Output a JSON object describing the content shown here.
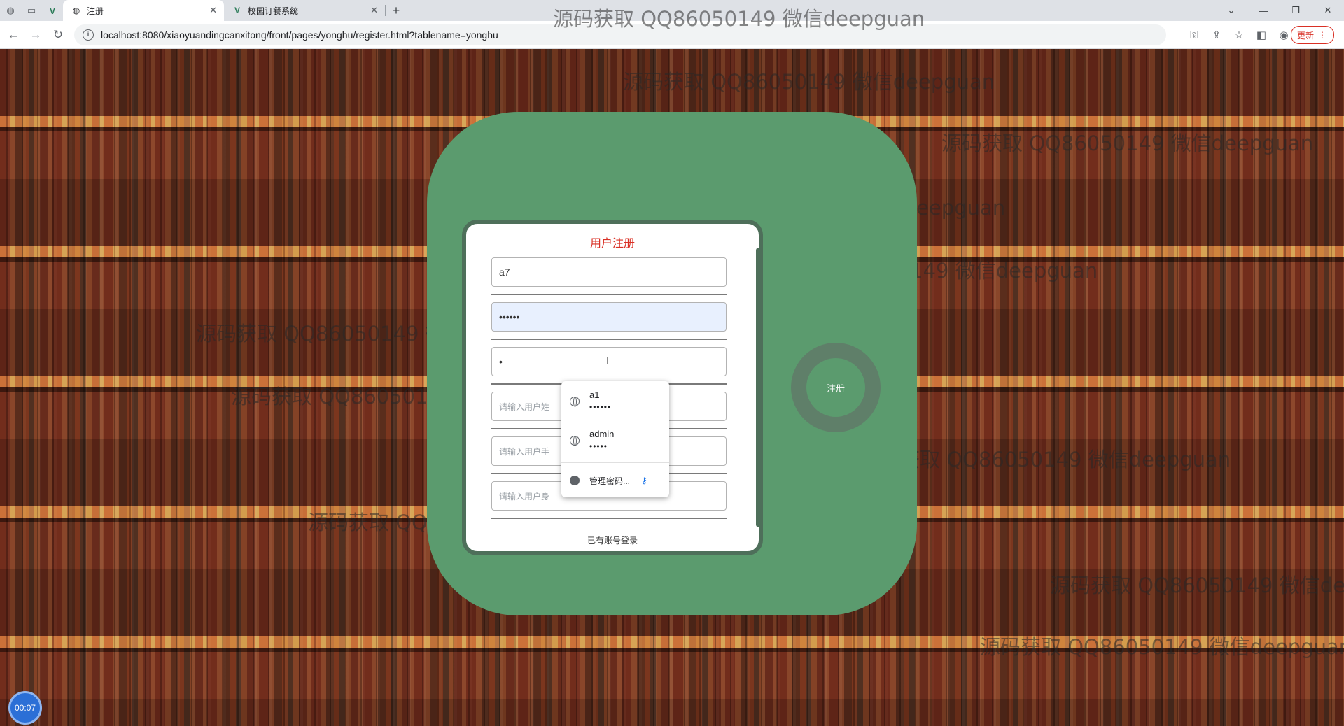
{
  "browser": {
    "tabs": [
      {
        "label": "",
        "icon": "globe-icon"
      },
      {
        "label": "",
        "icon": "blank-icon"
      },
      {
        "label": "",
        "icon": "v-logo-icon"
      },
      {
        "label": "注册",
        "icon": "globe-icon",
        "active": true
      },
      {
        "label": "校园订餐系统",
        "icon": "v-logo-icon"
      }
    ],
    "new_tab": "+",
    "url": "localhost:8080/xiaoyuandingcanxitong/front/pages/yonghu/register.html?tablename=yonghu",
    "update_label": "更新"
  },
  "watermarks": [
    "源码获取 QQ86050149 微信deepguan",
    "源码获取 QQ86050149 微信deepguan",
    "源码获取 QQ86050149 微信deepguan",
    "源码获取 QQ86050149 微信deepguan",
    "源码获取 QQ86050149 微信deepguan",
    "源码获取 QQ86050149 微信deepguan",
    "源码获取 QQ86050149 微信deepguan",
    "源码获取 QQ86050149 微信deepguan",
    "源码获取 QQ86050149 微信deepguan",
    "源码获取 QQ86050149 微信deepguan",
    "源码获取 QQ86050149 微信deepguan"
  ],
  "form": {
    "title": "用户注册",
    "account_value": "a7",
    "password_value": "••••••",
    "confirm_value": "•",
    "name_placeholder": "请输入用户姓",
    "phone_placeholder": "请输入用户手",
    "id_placeholder": "请输入用户身",
    "login_link": "已有账号登录",
    "register_button": "注册"
  },
  "autofill": {
    "entries": [
      {
        "username": "a1",
        "password": "••••••"
      },
      {
        "username": "admin",
        "password": "•••••"
      }
    ],
    "manage_label": "管理密码..."
  },
  "recorder": {
    "time": "00:07"
  }
}
